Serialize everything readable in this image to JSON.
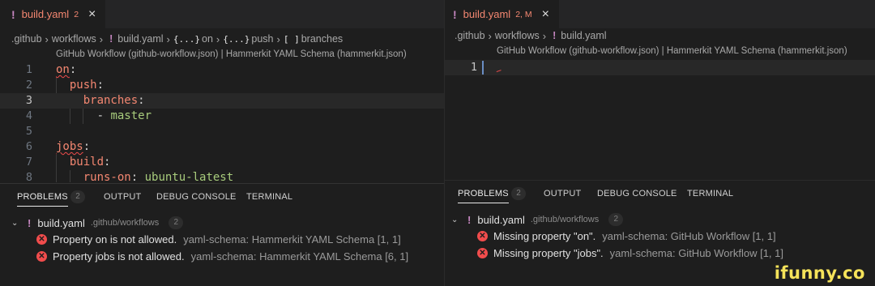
{
  "left": {
    "tab": {
      "name": "build.yaml",
      "badge": "2",
      "close": "×"
    },
    "breadcrumb": [
      ".github",
      "workflows",
      "build.yaml",
      "on",
      "push",
      "branches"
    ],
    "breadcrumb_symbols": [
      "{...}",
      "{...}",
      "[ ]"
    ],
    "schema": "GitHub Workflow (github-workflow.json) | Hammerkit YAML Schema (hammerkit.json)",
    "lines": [
      {
        "n": "1",
        "key": "on",
        "sep": ":",
        "val": ""
      },
      {
        "n": "2",
        "key": "push",
        "sep": ":",
        "val": ""
      },
      {
        "n": "3",
        "key": "branches",
        "sep": ":",
        "val": ""
      },
      {
        "n": "4",
        "key": "",
        "sep": "- ",
        "val": "master"
      },
      {
        "n": "5",
        "key": "",
        "sep": "",
        "val": ""
      },
      {
        "n": "6",
        "key": "jobs",
        "sep": ":",
        "val": ""
      },
      {
        "n": "7",
        "key": "build",
        "sep": ":",
        "val": ""
      },
      {
        "n": "8",
        "key": "runs-on",
        "sep": ": ",
        "val": "ubuntu-latest"
      }
    ],
    "panel": {
      "tabs": [
        "PROBLEMS",
        "OUTPUT",
        "DEBUG CONSOLE",
        "TERMINAL"
      ],
      "problems_count": "2",
      "group": {
        "file": "build.yaml",
        "path": ".github/workflows",
        "count": "2"
      },
      "problems": [
        {
          "msg": "Property on is not allowed.",
          "src": "yaml-schema: Hammerkit YAML Schema  [1, 1]"
        },
        {
          "msg": "Property jobs is not allowed.",
          "src": "yaml-schema: Hammerkit YAML Schema  [6, 1]"
        }
      ]
    }
  },
  "right": {
    "tab": {
      "name": "build.yaml",
      "badge": "2, M",
      "close": "×"
    },
    "breadcrumb": [
      ".github",
      "workflows",
      "build.yaml"
    ],
    "schema": "GitHub Workflow (github-workflow.json) | Hammerkit YAML Schema (hammerkit.json)",
    "lines": [
      {
        "n": "1"
      }
    ],
    "panel": {
      "tabs": [
        "PROBLEMS",
        "OUTPUT",
        "DEBUG CONSOLE",
        "TERMINAL"
      ],
      "problems_count": "2",
      "group": {
        "file": "build.yaml",
        "path": ".github/workflows",
        "count": "2"
      },
      "problems": [
        {
          "msg": "Missing property \"on\".",
          "src": "yaml-schema: GitHub Workflow  [1, 1]"
        },
        {
          "msg": "Missing property \"jobs\".",
          "src": "yaml-schema: GitHub Workflow  [1, 1]"
        }
      ]
    }
  },
  "watermark": "ifunny.co",
  "colors": {
    "key": "#f48771",
    "value": "#a8cc7c",
    "yaml_icon": "#c586c0",
    "error": "#f14c4c"
  }
}
